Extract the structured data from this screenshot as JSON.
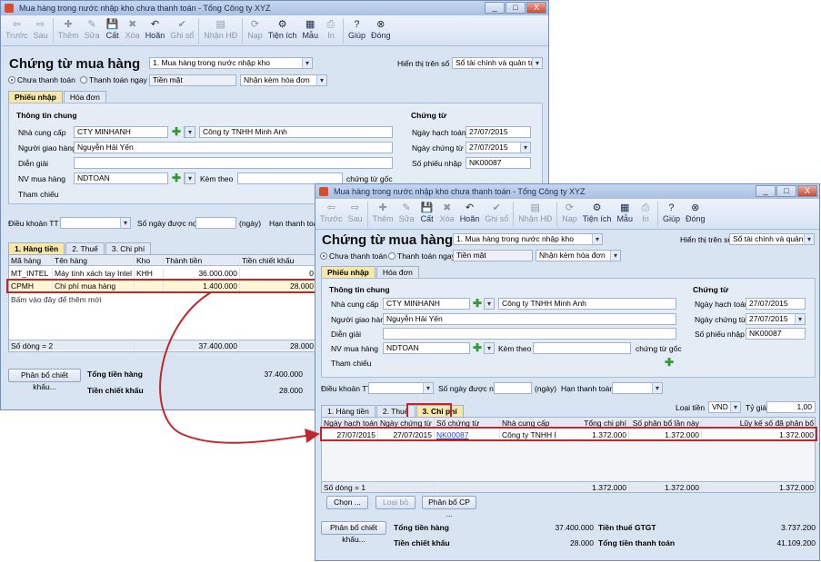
{
  "window": {
    "title": "Mua hàng trong nước nhập kho chưa thanh toán - Tổng Công ty XYZ",
    "controls": [
      "_",
      "□",
      "X"
    ]
  },
  "toolbar": [
    {
      "label": "Trước",
      "icon": "back-arrow-icon",
      "glyph": "⇦",
      "enabled": false
    },
    {
      "label": "Sau",
      "icon": "forward-arrow-icon",
      "glyph": "⇨",
      "enabled": false
    },
    {
      "label": "Thêm",
      "icon": "add-icon",
      "glyph": "✚",
      "enabled": false
    },
    {
      "label": "Sửa",
      "icon": "edit-icon",
      "glyph": "✎",
      "enabled": false
    },
    {
      "label": "Cất",
      "icon": "save-icon",
      "glyph": "💾",
      "enabled": true
    },
    {
      "label": "Xóa",
      "icon": "delete-icon",
      "glyph": "✖",
      "enabled": false
    },
    {
      "label": "Hoãn",
      "icon": "undo-icon",
      "glyph": "↶",
      "enabled": true
    },
    {
      "label": "Ghi sổ",
      "icon": "post-icon",
      "glyph": "✔",
      "enabled": false
    },
    {
      "label": "Nhận HĐ",
      "icon": "invoice-icon",
      "glyph": "▤",
      "enabled": false
    },
    {
      "label": "Nạp",
      "icon": "reload-icon",
      "glyph": "⟳",
      "enabled": false
    },
    {
      "label": "Tiện ích",
      "icon": "utilities-icon",
      "glyph": "⚙",
      "enabled": true
    },
    {
      "label": "Mẫu",
      "icon": "template-icon",
      "glyph": "▦",
      "enabled": true
    },
    {
      "label": "In",
      "icon": "print-icon",
      "glyph": "⎙",
      "enabled": false
    },
    {
      "label": "Giúp",
      "icon": "help-icon",
      "glyph": "?",
      "enabled": true
    },
    {
      "label": "Đóng",
      "icon": "close-window-icon",
      "glyph": "⊗",
      "enabled": true
    }
  ],
  "form": {
    "title": "Chứng từ mua hàng",
    "type": "1. Mua hàng trong nước nhập kho",
    "show_on_book_label": "Hiển thị trên sổ",
    "book": "Sổ tài chính và quản trị",
    "payment_unpaid": "Chưa thanh toán",
    "payment_paid": "Thanh toán ngay",
    "payment_method": "Tiền mặt",
    "invoice_option": "Nhận kèm hóa đơn",
    "tab_receipt": "Phiếu nhập",
    "tab_invoice": "Hóa đơn",
    "general_info_title": "Thông tin chung",
    "supplier_label": "Nhà cung cấp",
    "supplier_code": "CTY MINHANH",
    "supplier_name": "Công ty TNHH Minh Anh",
    "deliverer_label": "Người giao hàng",
    "deliverer": "Nguyễn Hải Yến",
    "description_label": "Diễn giải",
    "description": "",
    "employee_label": "NV mua hàng",
    "employee": "NDTOAN",
    "attached_label": "Kèm theo",
    "attached": "",
    "original_docs_label": "chứng từ gốc",
    "reference_label": "Tham chiếu",
    "voucher_title": "Chứng từ",
    "posting_date_label": "Ngày hạch toán",
    "posting_date": "27/07/2015",
    "voucher_date_label": "Ngày chứng từ",
    "voucher_date": "27/07/2015",
    "receipt_no_label": "Số phiếu nhập",
    "receipt_no": "NK00087",
    "terms_label": "Điều khoản TT",
    "terms": "",
    "days_label": "Số ngày được nợ",
    "days": "",
    "days_unit": "(ngày)",
    "due_label": "Hạn thanh toán",
    "due": "",
    "currency_label": "Loại tiền",
    "currency": "VND",
    "rate_label": "Tỷ giá",
    "rate": "1,00"
  },
  "detail_tabs": [
    "1. Hàng tiền",
    "2. Thuế",
    "3. Chi phí"
  ],
  "goods_grid": {
    "headers": [
      "Mã hàng",
      "Tên hàng",
      "Kho",
      "Thành tiền",
      "Tiền chiết khấu"
    ],
    "rows": [
      [
        "MT_INTEL",
        "Máy tính xách tay Intel",
        "KHH",
        "36.000.000",
        "0"
      ],
      [
        "CPMH",
        "Chi phí mua hàng",
        "",
        "1.400.000",
        "28.000"
      ]
    ],
    "add_hint": "Bấm vào đây để thêm mới",
    "row_count": "Số dòng = 2",
    "total_amount": "37.400.000",
    "total_discount": "28.000"
  },
  "cost_grid": {
    "headers": [
      "Ngày hạch toán",
      "Ngày chứng từ",
      "Số chứng từ",
      "Nhà cung cấp",
      "Tổng chi phí",
      "Số phân bổ lần này",
      "Lũy kế số đã phân bổ"
    ],
    "rows": [
      [
        "27/07/2015",
        "27/07/2015",
        "NK00087",
        "Công ty TNHH M",
        "1.372.000",
        "1.372.000",
        "1.372.000"
      ]
    ],
    "row_count": "Số dòng = 1",
    "total_cost": "1.372.000",
    "total_alloc": "1.372.000",
    "total_cumulative": "1.372.000"
  },
  "buttons": {
    "choose": "Chọn ...",
    "remove": "Loại bỏ",
    "allocate_cost": "Phân bổ CP ...",
    "allocate_discount": "Phân bổ chiết khấu..."
  },
  "totals": {
    "goods_label": "Tổng tiền hàng",
    "goods": "37.400.000",
    "discount_label": "Tiền chiết khấu",
    "discount": "28.000",
    "vat_label": "Tiền thuế GTGT",
    "vat": "3.737.200",
    "payment_label": "Tổng tiền thanh toán",
    "payment": "41.109.200"
  },
  "colors": {
    "highlight": "#c0262c",
    "active_tab": "#f9e7a8",
    "window_bg": "#d9e4f2"
  }
}
